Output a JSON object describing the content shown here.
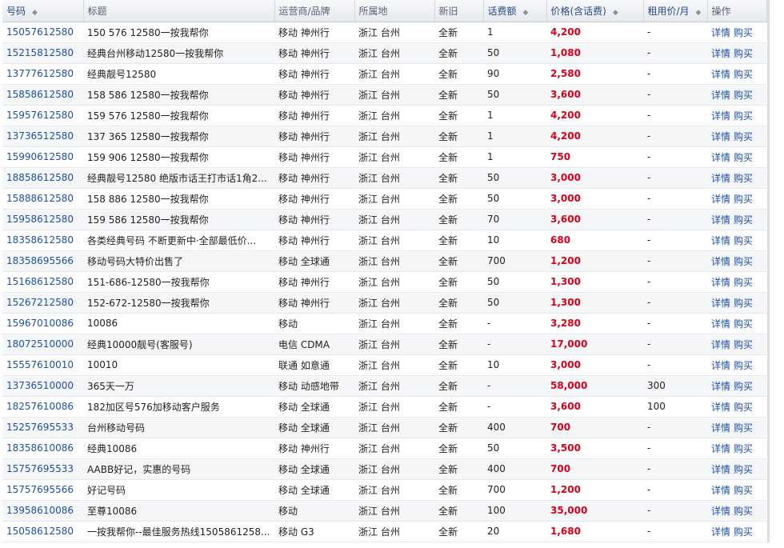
{
  "headers": [
    {
      "label": "号码",
      "sort": true
    },
    {
      "label": "标题",
      "sort": false
    },
    {
      "label": "运营商/品牌",
      "sort": false
    },
    {
      "label": "所属地",
      "sort": false
    },
    {
      "label": "新旧",
      "sort": false
    },
    {
      "label": "话费额",
      "sort": true
    },
    {
      "label": "价格(含话费)",
      "sort": true
    },
    {
      "label": "租用价/月",
      "sort": true
    },
    {
      "label": "操作",
      "sort": false
    }
  ],
  "sort_icon": "◆",
  "actions": {
    "detail": "详情",
    "buy": "购买"
  },
  "colors": {
    "link": "#1c4fa8",
    "price": "#d8001a"
  },
  "rows": [
    {
      "number": "15057612580",
      "title": "150 576 12580一按我帮你",
      "carrier": "移动 神州行",
      "location": "浙江 台州",
      "condition": "全新",
      "credit": "1",
      "price": "4,200",
      "rent": "-"
    },
    {
      "number": "15215812580",
      "title": "经典台州移动12580一按我帮你",
      "carrier": "移动 神州行",
      "location": "浙江 台州",
      "condition": "全新",
      "credit": "50",
      "price": "1,080",
      "rent": "-"
    },
    {
      "number": "13777612580",
      "title": "经典靓号12580",
      "carrier": "移动 神州行",
      "location": "浙江 台州",
      "condition": "全新",
      "credit": "90",
      "price": "2,580",
      "rent": "-"
    },
    {
      "number": "15858612580",
      "title": "158 586 12580一按我帮你",
      "carrier": "移动 神州行",
      "location": "浙江 台州",
      "condition": "全新",
      "credit": "50",
      "price": "3,600",
      "rent": "-"
    },
    {
      "number": "15957612580",
      "title": "159 576 12580一按我帮你",
      "carrier": "移动 神州行",
      "location": "浙江 台州",
      "condition": "全新",
      "credit": "1",
      "price": "4,200",
      "rent": "-"
    },
    {
      "number": "13736512580",
      "title": "137 365 12580一按我帮你",
      "carrier": "移动 神州行",
      "location": "浙江 台州",
      "condition": "全新",
      "credit": "1",
      "price": "4,200",
      "rent": "-"
    },
    {
      "number": "15990612580",
      "title": "159 906 12580一按我帮你",
      "carrier": "移动 神州行",
      "location": "浙江 台州",
      "condition": "全新",
      "credit": "1",
      "price": "750",
      "rent": "-"
    },
    {
      "number": "18858612580",
      "title": "经典靓号12580 绝版市话王打市话1角2...",
      "carrier": "移动 神州行",
      "location": "浙江 台州",
      "condition": "全新",
      "credit": "50",
      "price": "3,000",
      "rent": "-"
    },
    {
      "number": "15888612580",
      "title": "158 886 12580一按我帮你",
      "carrier": "移动 神州行",
      "location": "浙江 台州",
      "condition": "全新",
      "credit": "50",
      "price": "3,000",
      "rent": "-"
    },
    {
      "number": "15958612580",
      "title": "159 586 12580一按我帮你",
      "carrier": "移动 神州行",
      "location": "浙江 台州",
      "condition": "全新",
      "credit": "70",
      "price": "3,600",
      "rent": "-"
    },
    {
      "number": "18358612580",
      "title": "各类经典号码 不断更新中·全部最低价...",
      "carrier": "移动 神州行",
      "location": "浙江 台州",
      "condition": "全新",
      "credit": "10",
      "price": "680",
      "rent": "-"
    },
    {
      "number": "18358695566",
      "title": "移动号码大特价出售了",
      "carrier": "移动 全球通",
      "location": "浙江 台州",
      "condition": "全新",
      "credit": "700",
      "price": "1,200",
      "rent": "-"
    },
    {
      "number": "15168612580",
      "title": "151-686-12580一按我帮你",
      "carrier": "移动 神州行",
      "location": "浙江 台州",
      "condition": "全新",
      "credit": "50",
      "price": "1,300",
      "rent": "-"
    },
    {
      "number": "15267212580",
      "title": "152-672-12580一按我帮你",
      "carrier": "移动 神州行",
      "location": "浙江 台州",
      "condition": "全新",
      "credit": "50",
      "price": "1,300",
      "rent": "-"
    },
    {
      "number": "15967010086",
      "title": "10086",
      "carrier": "移动",
      "location": "浙江 台州",
      "condition": "全新",
      "credit": "-",
      "price": "3,280",
      "rent": "-"
    },
    {
      "number": "18072510000",
      "title": "经典10000靓号(客服号)",
      "carrier": "电信 CDMA",
      "location": "浙江 台州",
      "condition": "全新",
      "credit": "-",
      "price": "17,000",
      "rent": "-"
    },
    {
      "number": "15557610010",
      "title": "10010",
      "carrier": "联通 如意通",
      "location": "浙江 台州",
      "condition": "全新",
      "credit": "10",
      "price": "3,000",
      "rent": "-"
    },
    {
      "number": "13736510000",
      "title": "365天一万",
      "carrier": "移动 动感地带",
      "location": "浙江 台州",
      "condition": "全新",
      "credit": "-",
      "price": "58,000",
      "rent": "300"
    },
    {
      "number": "18257610086",
      "title": "182加区号576加移动客户服务",
      "carrier": "移动 全球通",
      "location": "浙江 台州",
      "condition": "全新",
      "credit": "-",
      "price": "3,600",
      "rent": "100"
    },
    {
      "number": "15257695533",
      "title": "台州移动号码",
      "carrier": "移动 全球通",
      "location": "浙江 台州",
      "condition": "全新",
      "credit": "400",
      "price": "700",
      "rent": "-"
    },
    {
      "number": "18358610086",
      "title": "经典10086",
      "carrier": "移动 神州行",
      "location": "浙江 台州",
      "condition": "全新",
      "credit": "50",
      "price": "3,500",
      "rent": "-"
    },
    {
      "number": "15757695533",
      "title": "AABB好记，实惠的号码",
      "carrier": "移动 全球通",
      "location": "浙江 台州",
      "condition": "全新",
      "credit": "400",
      "price": "700",
      "rent": "-"
    },
    {
      "number": "15757695566",
      "title": "好记号码",
      "carrier": "移动 全球通",
      "location": "浙江 台州",
      "condition": "全新",
      "credit": "700",
      "price": "1,200",
      "rent": "-"
    },
    {
      "number": "13958610086",
      "title": "至尊10086",
      "carrier": "移动",
      "location": "浙江 台州",
      "condition": "全新",
      "credit": "100",
      "price": "35,000",
      "rent": "-"
    },
    {
      "number": "15058612580",
      "title": "一按我帮你--最佳服务热线1505861258...",
      "carrier": "移动 G3",
      "location": "浙江 台州",
      "condition": "全新",
      "credit": "20",
      "price": "1,680",
      "rent": "-"
    }
  ]
}
